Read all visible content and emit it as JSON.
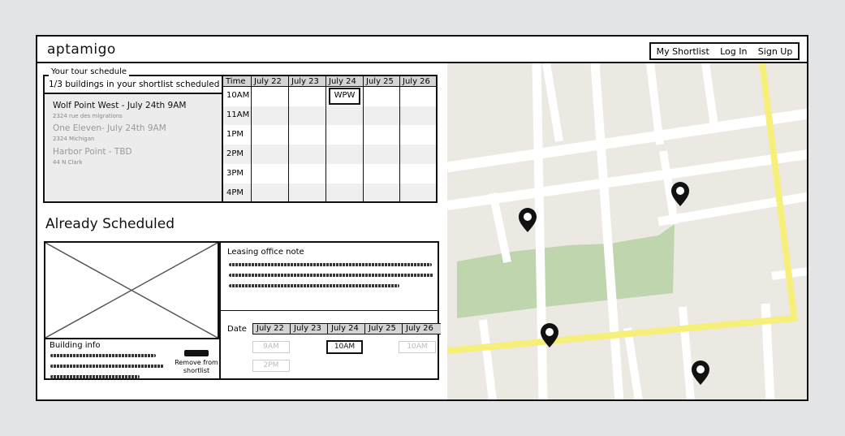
{
  "app": {
    "logo": "aptamigo"
  },
  "nav": {
    "shortlist": "My Shortlist",
    "login": "Log In",
    "signup": "Sign Up"
  },
  "tour": {
    "legend": "Your tour schedule",
    "summary": "1/3 buildings in your shortlist scheduled",
    "buildings": [
      {
        "name": "Wolf Point West - July 24th 9AM",
        "address": "2324 rue des migrations"
      },
      {
        "name": "One Eleven- July 24th 9AM",
        "address": "2324 Michigan"
      },
      {
        "name": "Harbor Point - TBD",
        "address": "44 N Clark"
      }
    ],
    "grid": {
      "time_header": "Time",
      "days": [
        "July 22",
        "July 23",
        "July 24",
        "July 25",
        "July 26"
      ],
      "times": [
        "10AM",
        "11AM",
        "1PM",
        "2PM",
        "3PM",
        "4PM"
      ],
      "booked_label": "WPW"
    }
  },
  "already": {
    "heading": "Already Scheduled",
    "building_info_title": "Building info",
    "remove_label": "Remove from shortlist",
    "note_title": "Leasing office note",
    "date_label": "Date",
    "days": [
      "July 22",
      "July 23",
      "July 24",
      "July 25",
      "July 26"
    ],
    "slots": {
      "a": "9AM",
      "b": "2PM",
      "selected": "10AM",
      "c": "10AM"
    }
  },
  "colors": {
    "park": "#bfd5ad",
    "highway": "#f6ef7a",
    "road": "#ffffff",
    "map_bg": "#ece8e2"
  }
}
